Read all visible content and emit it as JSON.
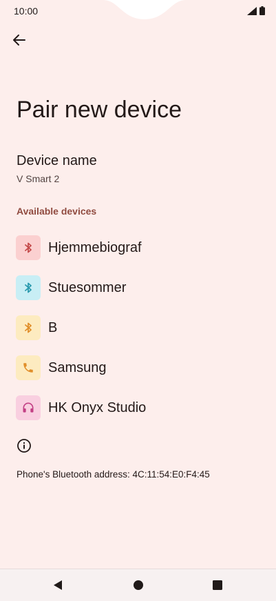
{
  "status_bar": {
    "time": "10:00"
  },
  "page": {
    "title": "Pair new device"
  },
  "device_name": {
    "label": "Device name",
    "value": "V Smart 2"
  },
  "available": {
    "header": "Available devices",
    "devices": [
      {
        "name": "Hjemmebiograf",
        "icon": "bluetooth-icon",
        "bg": "#fbd0d0",
        "fg": "#c44a4a"
      },
      {
        "name": "Stuesommer",
        "icon": "bluetooth-icon",
        "bg": "#c8eef5",
        "fg": "#2a9aae"
      },
      {
        "name": "B",
        "icon": "bluetooth-icon",
        "bg": "#fdebc0",
        "fg": "#e08e2a"
      },
      {
        "name": "Samsung",
        "icon": "phone-icon",
        "bg": "#fdebc0",
        "fg": "#e08e2a"
      },
      {
        "name": "HK Onyx Studio",
        "icon": "headphones-icon",
        "bg": "#f9cfe0",
        "fg": "#c23f84"
      }
    ]
  },
  "footer": {
    "bluetooth_address": "Phone's Bluetooth address: 4C:11:54:E0:F4:45"
  }
}
